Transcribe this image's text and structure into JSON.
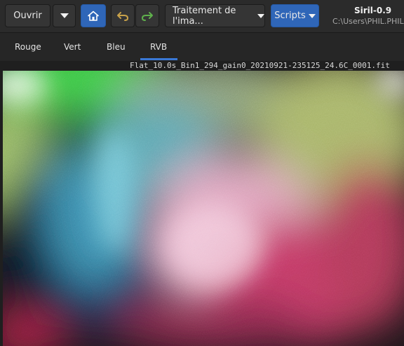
{
  "toolbar": {
    "open_label": "Ouvrir",
    "image_processing_label": "Traitement de l'ima...",
    "scripts_label": "Scripts",
    "app_title": "Siril-0.9",
    "path": "C:\\Users\\PHIL.PHIL",
    "icons": {
      "open_menu": "chevron-down-icon",
      "home": "home-icon",
      "undo": "undo-icon",
      "redo": "redo-icon"
    }
  },
  "tabs": [
    "Rouge",
    "Vert",
    "Bleu",
    "RVB"
  ],
  "active_tab": "RVB",
  "image": {
    "filename": "Flat_10.0s_Bin1_294_gain0_20210921-235125_24.6C_0001.fit"
  },
  "colors": {
    "accent_blue": "#2f66b8",
    "tab_underline": "#3a78d6",
    "undo_color": "#c9a24a",
    "redo_color": "#5fb04c"
  }
}
